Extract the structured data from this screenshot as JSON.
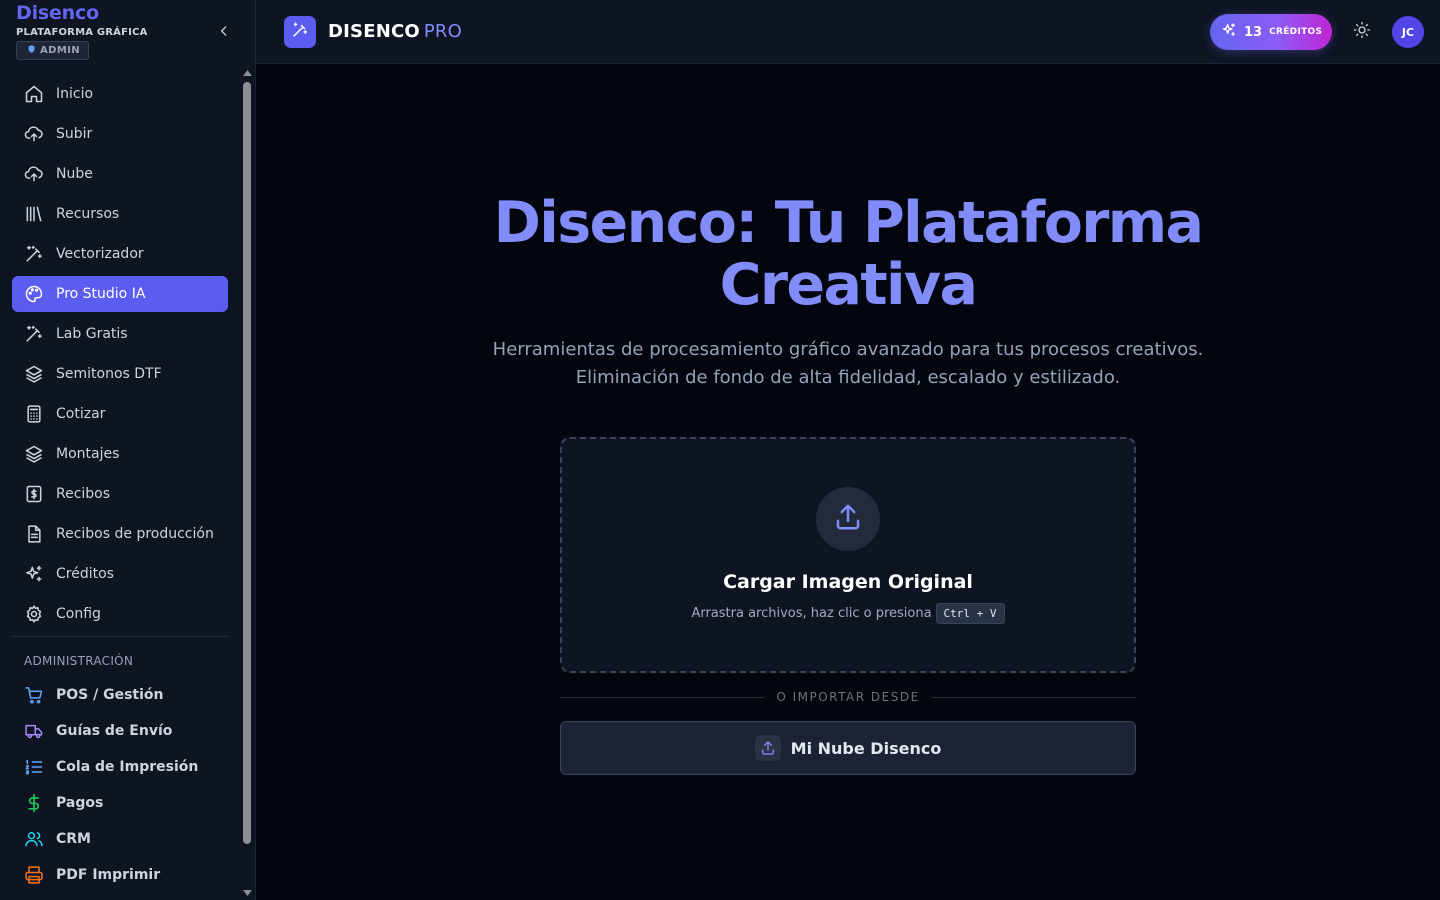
{
  "brand": {
    "name": "Disenco",
    "subtitle": "PLATAFORMA GRÁFICA",
    "role_badge": "ADMIN"
  },
  "sidebar": {
    "items": [
      {
        "label": "Inicio",
        "icon": "home-icon",
        "active": false
      },
      {
        "label": "Subir",
        "icon": "cloud-upload-icon",
        "active": false
      },
      {
        "label": "Nube",
        "icon": "cloud-upload-icon",
        "active": false
      },
      {
        "label": "Recursos",
        "icon": "library-icon",
        "active": false
      },
      {
        "label": "Vectorizador",
        "icon": "magic-wand-icon",
        "active": false
      },
      {
        "label": "Pro Studio IA",
        "icon": "palette-icon",
        "active": true
      },
      {
        "label": "Lab Gratis",
        "icon": "magic-wand-icon",
        "active": false
      },
      {
        "label": "Semitonos DTF",
        "icon": "layers-icon",
        "active": false
      },
      {
        "label": "Cotizar",
        "icon": "calculator-icon",
        "active": false
      },
      {
        "label": "Montajes",
        "icon": "layers-icon",
        "active": false
      },
      {
        "label": "Recibos",
        "icon": "receipt-dollar-icon",
        "active": false
      },
      {
        "label": "Recibos de producción",
        "icon": "file-text-icon",
        "active": false
      },
      {
        "label": "Créditos",
        "icon": "sparkles-icon",
        "active": false
      },
      {
        "label": "Config",
        "icon": "gear-icon",
        "active": false
      }
    ],
    "admin_section": {
      "label": "ADMINISTRACIÓN",
      "items": [
        {
          "label": "POS / Gestión",
          "icon": "shopping-cart-icon",
          "color": "#60a5fa"
        },
        {
          "label": "Guías de Envío",
          "icon": "truck-icon",
          "color": "#a78bfa"
        },
        {
          "label": "Cola de Impresión",
          "icon": "list-ordered-icon",
          "color": "#60a5fa"
        },
        {
          "label": "Pagos",
          "icon": "dollar-icon",
          "color": "#22c55e"
        },
        {
          "label": "CRM",
          "icon": "users-icon",
          "color": "#22d3ee"
        },
        {
          "label": "PDF Imprimir",
          "icon": "printer-icon",
          "color": "#f97316"
        }
      ]
    }
  },
  "header": {
    "app_name": "DISENCO",
    "app_suffix": "PRO",
    "credits_count": "13",
    "credits_label": "CRÉDITOS",
    "avatar_initials": "JC"
  },
  "hero": {
    "title": "Disenco: Tu Plataforma Creativa",
    "subtitle_line1": "Herramientas de procesamiento gráfico avanzado para tus procesos creativos.",
    "subtitle_line2": "Eliminación de fondo de alta fidelidad, escalado y estilizado."
  },
  "upload": {
    "title": "Cargar Imagen Original",
    "hint": "Arrastra archivos, haz clic o presiona",
    "shortcut": "Ctrl + V",
    "divider_text": "O IMPORTAR DESDE",
    "cloud_button": "Mi Nube Disenco"
  },
  "colors": {
    "accent": "#5b5cf0",
    "hero_title": "#818cf8",
    "background": "#03050f",
    "panel": "#0f1422"
  }
}
